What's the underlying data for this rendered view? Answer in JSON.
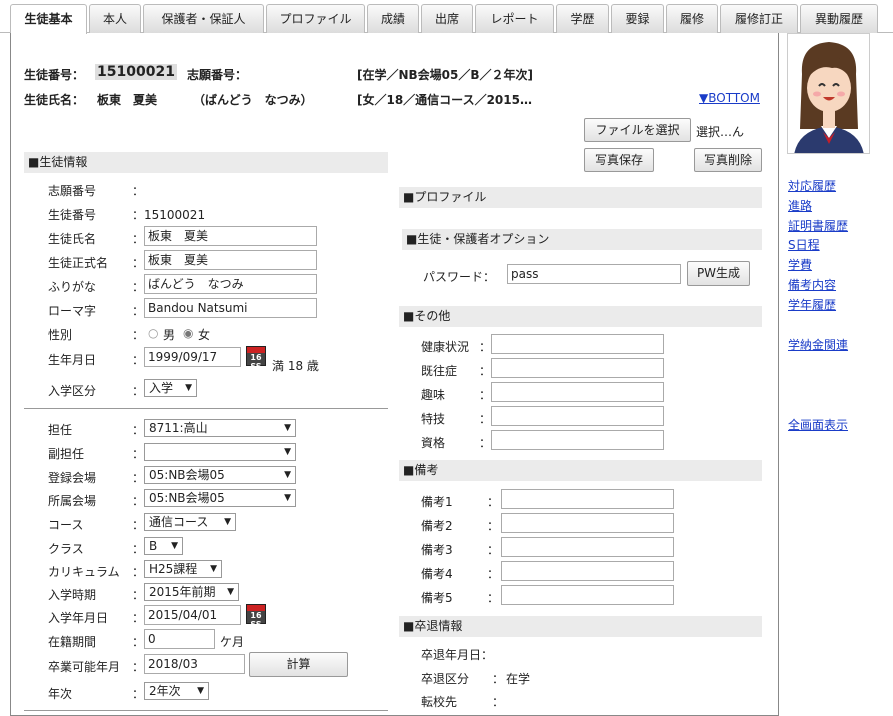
{
  "tabs": [
    "生徒基本",
    "本人",
    "保護者・保証人",
    "プロファイル",
    "成績",
    "出席",
    "レポート",
    "学歴",
    "要録",
    "履修",
    "履修訂正",
    "異動履歴"
  ],
  "header": {
    "student_no_label": "生徒番号：",
    "student_no": "15100021",
    "app_no_label": "志願番号：",
    "status1": "[在学／NB会場05／B／２年次]",
    "name_label": "生徒氏名：",
    "name": "板東　夏美",
    "kana": "（ばんどう　なつみ）",
    "status2": "[女／18／通信コース／2015…",
    "bottom_link": "▼BOTTOM"
  },
  "photo": {
    "choose_file": "ファイルを選択",
    "choose_status": "選択…ん",
    "save": "写真保存",
    "delete": "写真削除"
  },
  "right_links": [
    "対応履歴",
    "進路",
    "証明書履歴",
    "S日程",
    "学費",
    "備考内容",
    "学年履歴",
    "学納金関連",
    "全画面表示"
  ],
  "info": {
    "section": "■生徒情報",
    "app_no_label": "志願番号",
    "app_no_colon": "：",
    "student_no_label": "生徒番号",
    "student_no": "：15100021",
    "name_label": "生徒氏名",
    "name": "板東　夏美",
    "official_label": "生徒正式名",
    "official": "板東　夏美",
    "kana_label": "ふりがな",
    "kana": "ばんどう　なつみ",
    "romaji_label": "ローマ字",
    "romaji": "Bandou Natsumi",
    "gender_label": "性別",
    "male": "男",
    "female": "女",
    "birth_label": "生年月日",
    "birth": "1999/09/17",
    "age": "満 18 歳",
    "entry_type_label": "入学区分",
    "entry_type": "入学",
    "teacher_label": "担任",
    "teacher": "8711:高山",
    "sub_teacher_label": "副担任",
    "sub_teacher": "",
    "reg_site_label": "登録会場",
    "reg_site": "05:NB会場05",
    "site_label": "所属会場",
    "site": "05:NB会場05",
    "course_label": "コース",
    "course": "通信コース",
    "class_label": "クラス",
    "class": "B",
    "curriculum_label": "カリキュラム",
    "curriculum": "H25課程",
    "entry_period_label": "入学時期",
    "entry_period": "2015年前期",
    "entry_date_label": "入学年月日",
    "entry_date": "2015/04/01",
    "enroll_label": "在籍期間",
    "enroll": "0",
    "enroll_unit": "ケ月",
    "grad_label": "卒業可能年月",
    "grad": "2018/03",
    "calc": "計算",
    "year_label": "年次",
    "year": "2年次"
  },
  "profile": {
    "section": "■プロファイル"
  },
  "options": {
    "section": "■生徒・保護者オプション",
    "pw_label": "パスワード：",
    "pw": "pass",
    "pw_btn": "PW生成"
  },
  "other": {
    "section": "■その他",
    "fields": [
      "健康状況",
      "既往症",
      "趣味",
      "特技",
      "資格"
    ]
  },
  "notes": {
    "section": "■備考",
    "fields": [
      "備考1",
      "備考2",
      "備考3",
      "備考4",
      "備考5"
    ]
  },
  "grad": {
    "section": "■卒退情報",
    "date_label": "卒退年月日：",
    "type_label": "卒退区分",
    "type": "在学",
    "transfer_label": "転校先"
  },
  "colon": "："
}
